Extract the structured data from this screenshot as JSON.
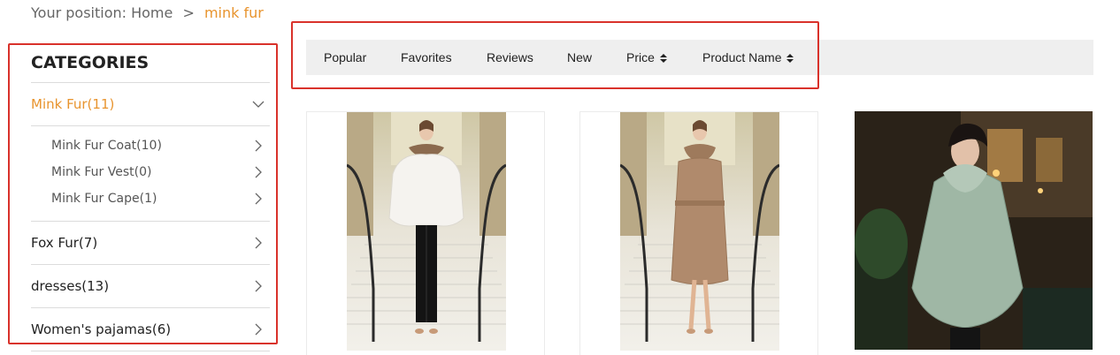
{
  "breadcrumb": {
    "prefix": "Your position:",
    "home": "Home",
    "separator": ">",
    "current": "mink fur"
  },
  "sidebar": {
    "title": "CATEGORIES",
    "categories": [
      {
        "label": "Mink Fur(11)",
        "expanded": true,
        "icon": "chevron-down-icon",
        "children": [
          {
            "label": "Mink Fur Coat(10)",
            "icon": "chevron-right-icon"
          },
          {
            "label": "Mink Fur Vest(0)",
            "icon": "chevron-right-icon"
          },
          {
            "label": "Mink Fur Cape(1)",
            "icon": "chevron-right-icon"
          }
        ]
      },
      {
        "label": "Fox Fur(7)",
        "icon": "chevron-right-icon"
      },
      {
        "label": "dresses(13)",
        "icon": "chevron-right-icon"
      },
      {
        "label": "Women's pajamas(6)",
        "icon": "chevron-right-icon"
      }
    ]
  },
  "sort_bar": {
    "items": [
      {
        "label": "Popular"
      },
      {
        "label": "Favorites"
      },
      {
        "label": "Reviews"
      },
      {
        "label": "New"
      },
      {
        "label": "Price",
        "icon": "sort-updown-icon"
      },
      {
        "label": "Product Name",
        "icon": "sort-updown-icon"
      }
    ]
  },
  "products": [
    {
      "image": "white mink fur jacket with fox collar on staircase"
    },
    {
      "image": "brown mink fur coat with belt on staircase"
    },
    {
      "image": "sage green mink fur jacket with hood in restaurant"
    }
  ],
  "colors": {
    "accent": "#e8942e",
    "highlight_outline": "#d9322b",
    "sort_bar_bg": "#efefef",
    "divider": "#dcdcdc"
  }
}
